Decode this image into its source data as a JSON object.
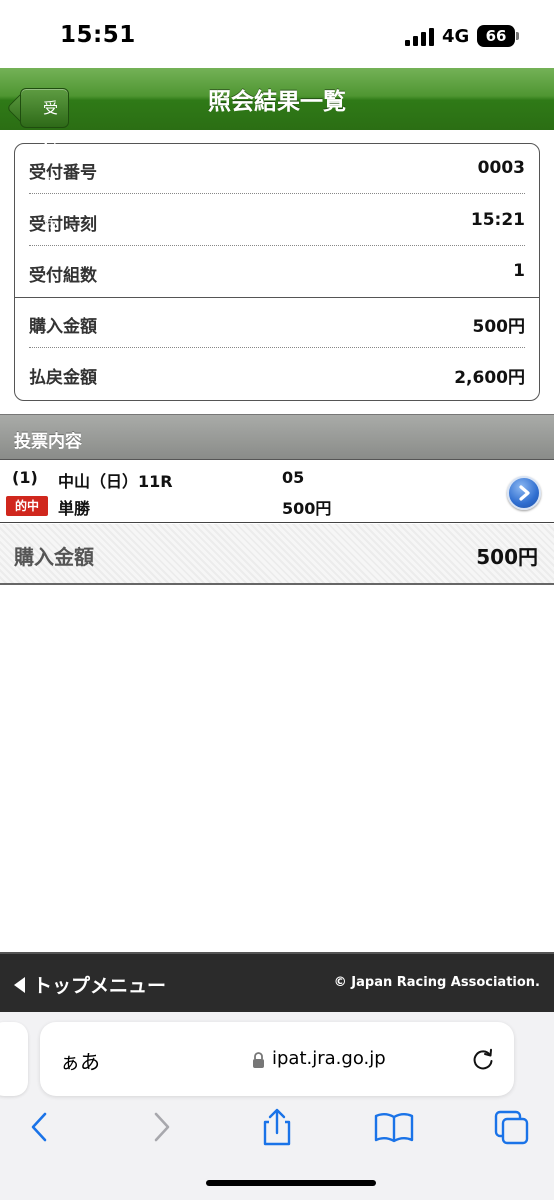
{
  "status_bar": {
    "time": "15:51",
    "network": "4G",
    "battery": "66"
  },
  "header": {
    "back_label": "受付番号",
    "title": "照会結果一覧"
  },
  "summary": {
    "rows": [
      {
        "label": "受付番号",
        "value": "0003"
      },
      {
        "label": "受付時刻",
        "value": "15:21"
      },
      {
        "label": "受付組数",
        "value": "1"
      },
      {
        "label": "購入金額",
        "value": "500円"
      },
      {
        "label": "払戻金額",
        "value": "2,600円"
      }
    ]
  },
  "section": {
    "title": "投票内容"
  },
  "bet": {
    "number": "(1)",
    "race": "中山（日）11R",
    "selection": "05",
    "badge": "的中",
    "type": "単勝",
    "amount": "500円"
  },
  "total": {
    "label": "購入金額",
    "value": "500円"
  },
  "footer": {
    "top_menu": "トップメニュー",
    "copyright": "© Japan Racing Association."
  },
  "browser": {
    "aa": "ぁあ",
    "url": "ipat.jra.go.jp"
  },
  "colors": {
    "header_green": "#3f8a24",
    "hit_red": "#d0271d",
    "ios_blue": "#1a73e8"
  }
}
